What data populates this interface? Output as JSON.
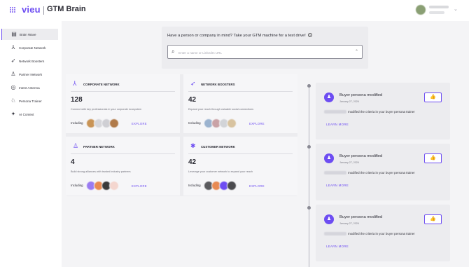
{
  "header": {
    "logo": "vieu",
    "title": "GTM Brain",
    "user": {
      "name_blurred": "",
      "org_blurred": ""
    }
  },
  "sidebar": {
    "items": [
      {
        "label": "Brain Wave",
        "icon": "brain-wave-icon",
        "glyph": "▤",
        "active": true
      },
      {
        "label": "Corporate Network",
        "icon": "corporate-network-icon",
        "glyph": "⅄",
        "active": false
      },
      {
        "label": "Network Boosters",
        "icon": "rocket-icon",
        "glyph": "➶",
        "active": false
      },
      {
        "label": "Partner Network",
        "icon": "partner-icon",
        "glyph": "♙",
        "active": false
      },
      {
        "label": "Intent Antenna",
        "icon": "antenna-icon",
        "glyph": "◎",
        "active": false
      },
      {
        "label": "Persona Trainer",
        "icon": "persona-icon",
        "glyph": "♘",
        "active": false
      },
      {
        "label": "AI Context",
        "icon": "sparkle-icon",
        "glyph": "✦",
        "active": false
      }
    ]
  },
  "test_drive": {
    "prompt": "Have a person or company in mind? Take your GTM machine for a test drive!",
    "help_glyph": "?",
    "search_placeholder": "Enter a name or LinkedIn URL",
    "search_value": ""
  },
  "networks": [
    {
      "title": "CORPORATE NETWORK",
      "icon": "corporate-network-icon",
      "glyph": "⅄",
      "count": "128",
      "description": "Connect with key professionals in your corporate ecosystem",
      "including": "Including",
      "explore": "EXPLORE",
      "logo_colors": [
        "#c99456",
        "#d6d6da",
        "#cfcfd4",
        "#b07a4a"
      ]
    },
    {
      "title": "NETWORK BOOSTERS",
      "icon": "rocket-icon",
      "glyph": "➶",
      "count": "42",
      "description": "Expand your reach through valuable social connections",
      "including": "Including",
      "explore": "EXPLORE",
      "logo_colors": [
        "#9bb3cf",
        "#c9a2a6",
        "#d2d4d8",
        "#d8c3a0"
      ]
    },
    {
      "title": "PARTNER NETWORK",
      "icon": "partner-icon",
      "glyph": "♙",
      "count": "4",
      "description": "Build strong alliances with trusted industry partners",
      "including": "Including",
      "explore": "EXPLORE",
      "logo_colors": [
        "#9a7bf2",
        "#e88a52",
        "#3a3a3a",
        "#f4d6cf"
      ]
    },
    {
      "title": "CUSTOMER NETWORK",
      "icon": "customer-icon",
      "glyph": "✱",
      "count": "42",
      "description": "Leverage your customer network to expand your reach",
      "including": "Including",
      "explore": "EXPLORE",
      "logo_colors": [
        "#5a5a5e",
        "#e88a52",
        "#6d4df2",
        "#4a4a4e"
      ]
    }
  ],
  "activity": [
    {
      "title": "Buyer persona modified",
      "date": "January 27, 2026",
      "message": "modified the criteria in your buyer persona trainer",
      "learn_more": "LEARN MORE",
      "avatar_glyph": "♟",
      "like_glyph": "👍"
    },
    {
      "title": "Buyer persona modified",
      "date": "January 27, 2026",
      "message": "modified the criteria in your buyer persona trainer",
      "learn_more": "LEARN MORE",
      "avatar_glyph": "♟",
      "like_glyph": "👍"
    },
    {
      "title": "Buyer persona modified",
      "date": "January 27, 2026",
      "message": "modified the criteria in your buyer persona trainer",
      "learn_more": "LEARN MORE",
      "avatar_glyph": "♟",
      "like_glyph": "👍"
    }
  ],
  "colors": {
    "accent": "#6d4df2",
    "background": "#f4f4f6",
    "panel": "#ececef"
  }
}
